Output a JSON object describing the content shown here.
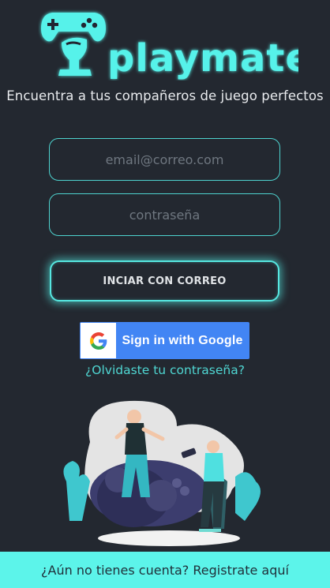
{
  "brand": {
    "name": "playmates",
    "logo_icon": "gamepad-hand-icon"
  },
  "tagline": "Encuentra a tus compañeros de juego perfectos",
  "form": {
    "email_placeholder": "email@correo.com",
    "password_placeholder": "contraseña",
    "email_login_label": "INCIAR CON CORREO",
    "google_label": "Sign in with Google",
    "forgot_label": "¿Olvidaste tu contraseña?"
  },
  "footer": {
    "register_label": "¿Aún no tienes cuenta? Registrate aquí"
  },
  "colors": {
    "background": "#232830",
    "accent": "#5cf4ea",
    "google_blue": "#4285f4",
    "link": "#4fd6d2"
  },
  "illustration": {
    "icon": "gamers-with-controller-illustration"
  }
}
